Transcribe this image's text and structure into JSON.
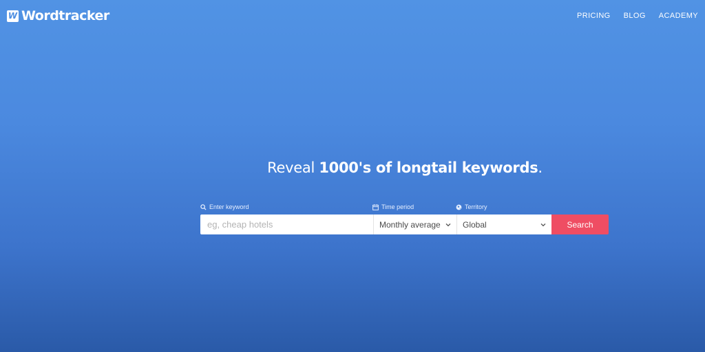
{
  "brand": {
    "logo_letter": "W",
    "name": "Wordtracker"
  },
  "nav": {
    "pricing": "PRICING",
    "blog": "BLOG",
    "academy": "ACADEMY"
  },
  "hero": {
    "headline_light": "Reveal ",
    "headline_bold": "1000's of longtail keywords",
    "headline_end": "."
  },
  "search": {
    "keyword_label": "Enter keyword",
    "keyword_placeholder": "eg, cheap hotels",
    "keyword_value": "",
    "period_label": "Time period",
    "period_value": "Monthly average",
    "territory_label": "Territory",
    "territory_value": "Global",
    "button_label": "Search"
  },
  "icons": {
    "keyword_label_icon": "search-icon",
    "period_label_icon": "calendar-icon",
    "territory_label_icon": "globe-icon",
    "dropdown_icon": "chevron-down-icon"
  },
  "colors": {
    "background_top": "#5193e4",
    "background_bottom": "#2a5aa8",
    "search_button": "#ef4d63"
  }
}
